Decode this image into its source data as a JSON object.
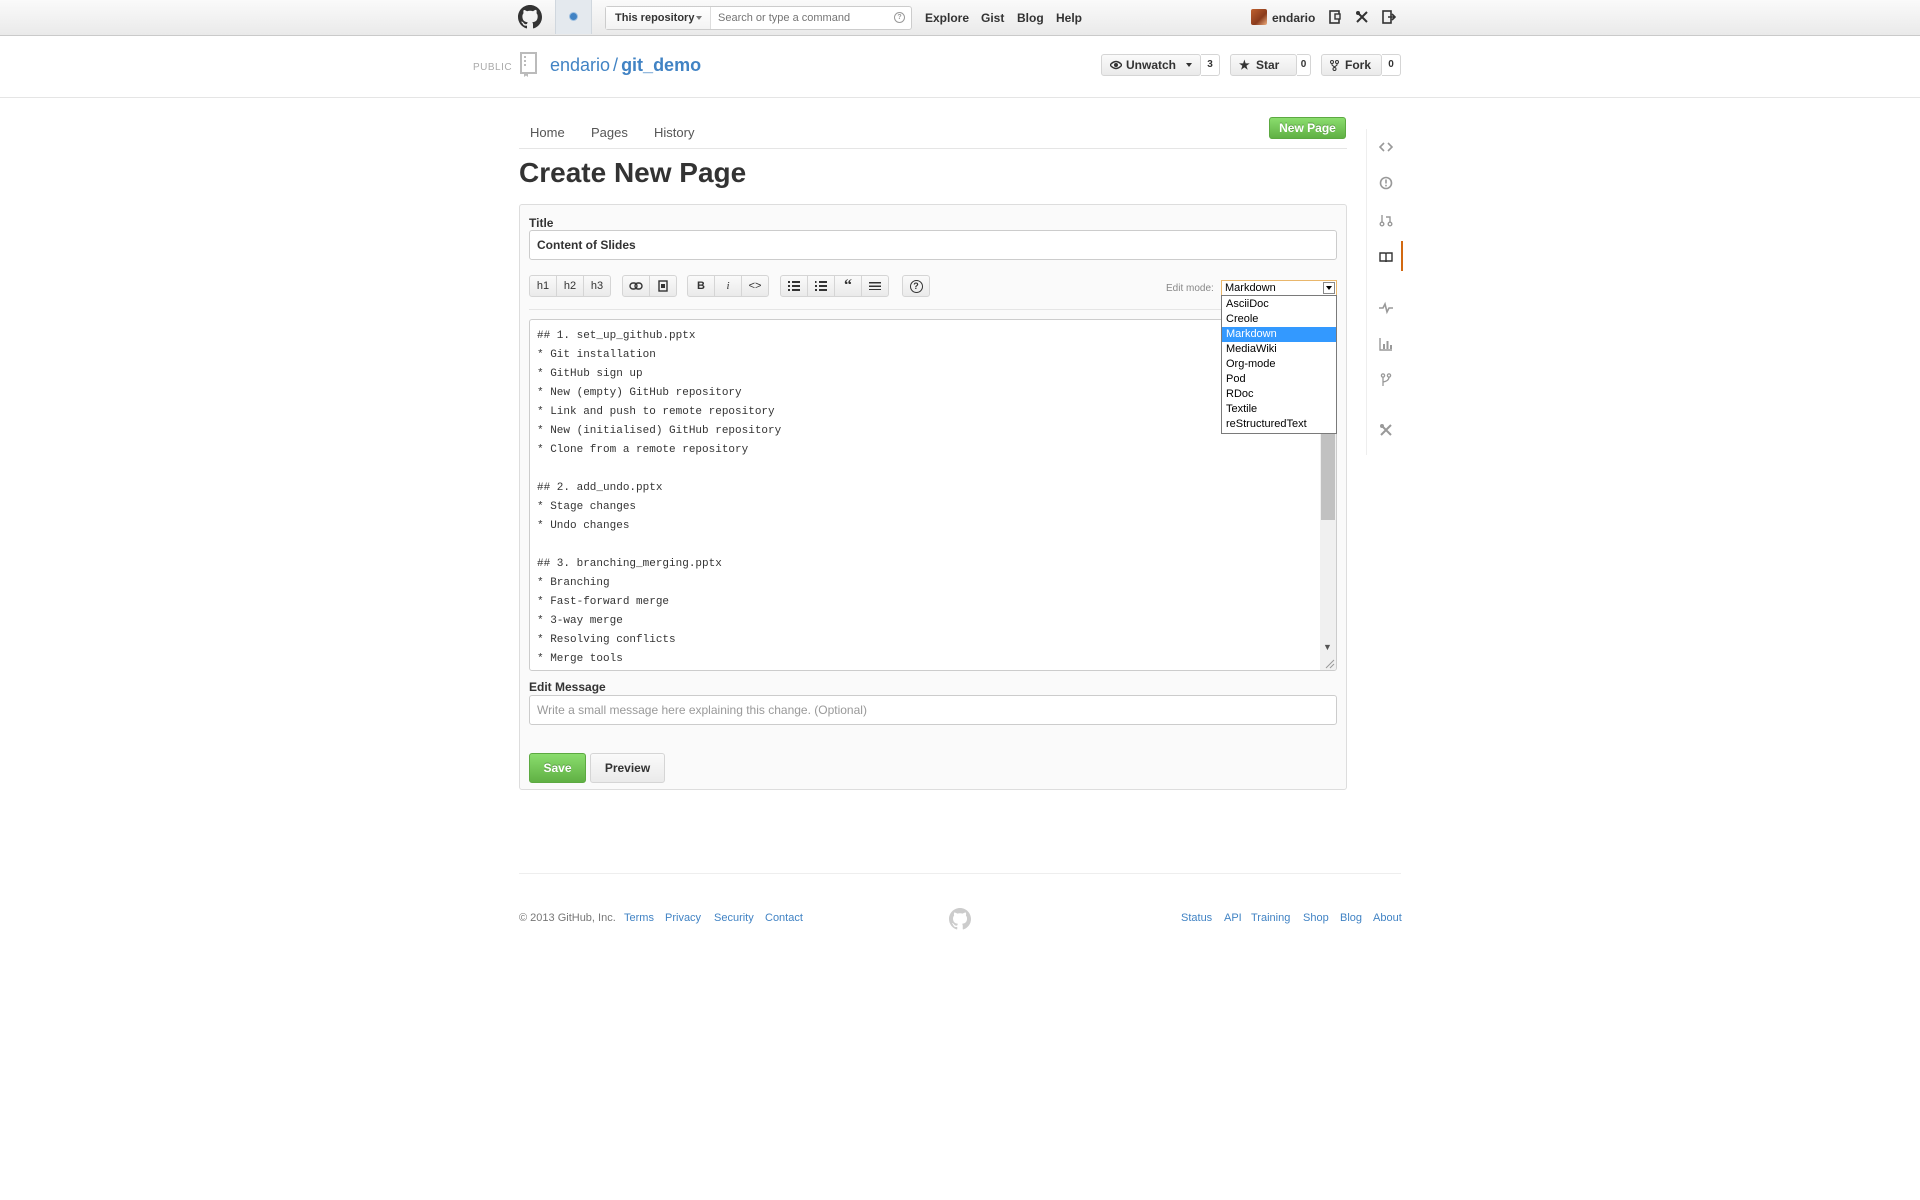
{
  "header": {
    "scope_label": "This repository",
    "search_placeholder": "Search or type a command",
    "search_help": "?",
    "nav": [
      "Explore",
      "Gist",
      "Blog",
      "Help"
    ],
    "username": "endario"
  },
  "repo": {
    "visibility": "PUBLIC",
    "owner": "endario",
    "separator": "/",
    "name": "git_demo",
    "unwatch_label": "Unwatch",
    "watch_count": "3",
    "star_label": "Star",
    "star_count": "0",
    "fork_label": "Fork",
    "fork_count": "0"
  },
  "wiki": {
    "nav": [
      "Home",
      "Pages",
      "History"
    ],
    "new_page_label": "New Page",
    "page_title": "Create New Page"
  },
  "form": {
    "title_label": "Title",
    "title_value": "Content of Slides",
    "toolbar": {
      "headings": [
        "h1",
        "h2",
        "h3"
      ],
      "bold": "B",
      "italic": "i",
      "code": "<>",
      "quote": "“",
      "help": "?"
    },
    "edit_mode_label": "Edit mode:",
    "edit_mode_selected": "Markdown",
    "edit_mode_options": [
      "AsciiDoc",
      "Creole",
      "Markdown",
      "MediaWiki",
      "Org-mode",
      "Pod",
      "RDoc",
      "Textile",
      "reStructuredText"
    ],
    "body": "## 1. set_up_github.pptx\n* Git installation\n* GitHub sign up\n* New (empty) GitHub repository\n* Link and push to remote repository\n* New (initialised) GitHub repository\n* Clone from a remote repository\n\n## 2. add_undo.pptx\n* Stage changes\n* Undo changes\n\n## 3. branching_merging.pptx\n* Branching\n* Fast-forward merge\n* 3-way merge\n* Resolving conflicts\n* Merge tools",
    "message_label": "Edit Message",
    "message_placeholder": "Write a small message here explaining this change. (Optional)",
    "save_label": "Save",
    "preview_label": "Preview"
  },
  "footer": {
    "copyright": "© 2013 GitHub, Inc.",
    "left_links": [
      "Terms",
      "Privacy",
      "Security",
      "Contact"
    ],
    "right_links": [
      "Status",
      "API",
      "Training",
      "Shop",
      "Blog",
      "About"
    ]
  },
  "colors": {
    "link": "#4183c4",
    "green": "#60b044",
    "active_tab": "#d26911",
    "selected_option": "#3399ff"
  },
  "icons": [
    "github-logo-icon",
    "notification-icon",
    "repo-book-icon",
    "eye-icon",
    "star-icon",
    "fork-icon",
    "code-icon",
    "issues-icon",
    "pull-request-icon",
    "wiki-icon",
    "pulse-icon",
    "graphs-icon",
    "network-icon",
    "settings-icon"
  ]
}
